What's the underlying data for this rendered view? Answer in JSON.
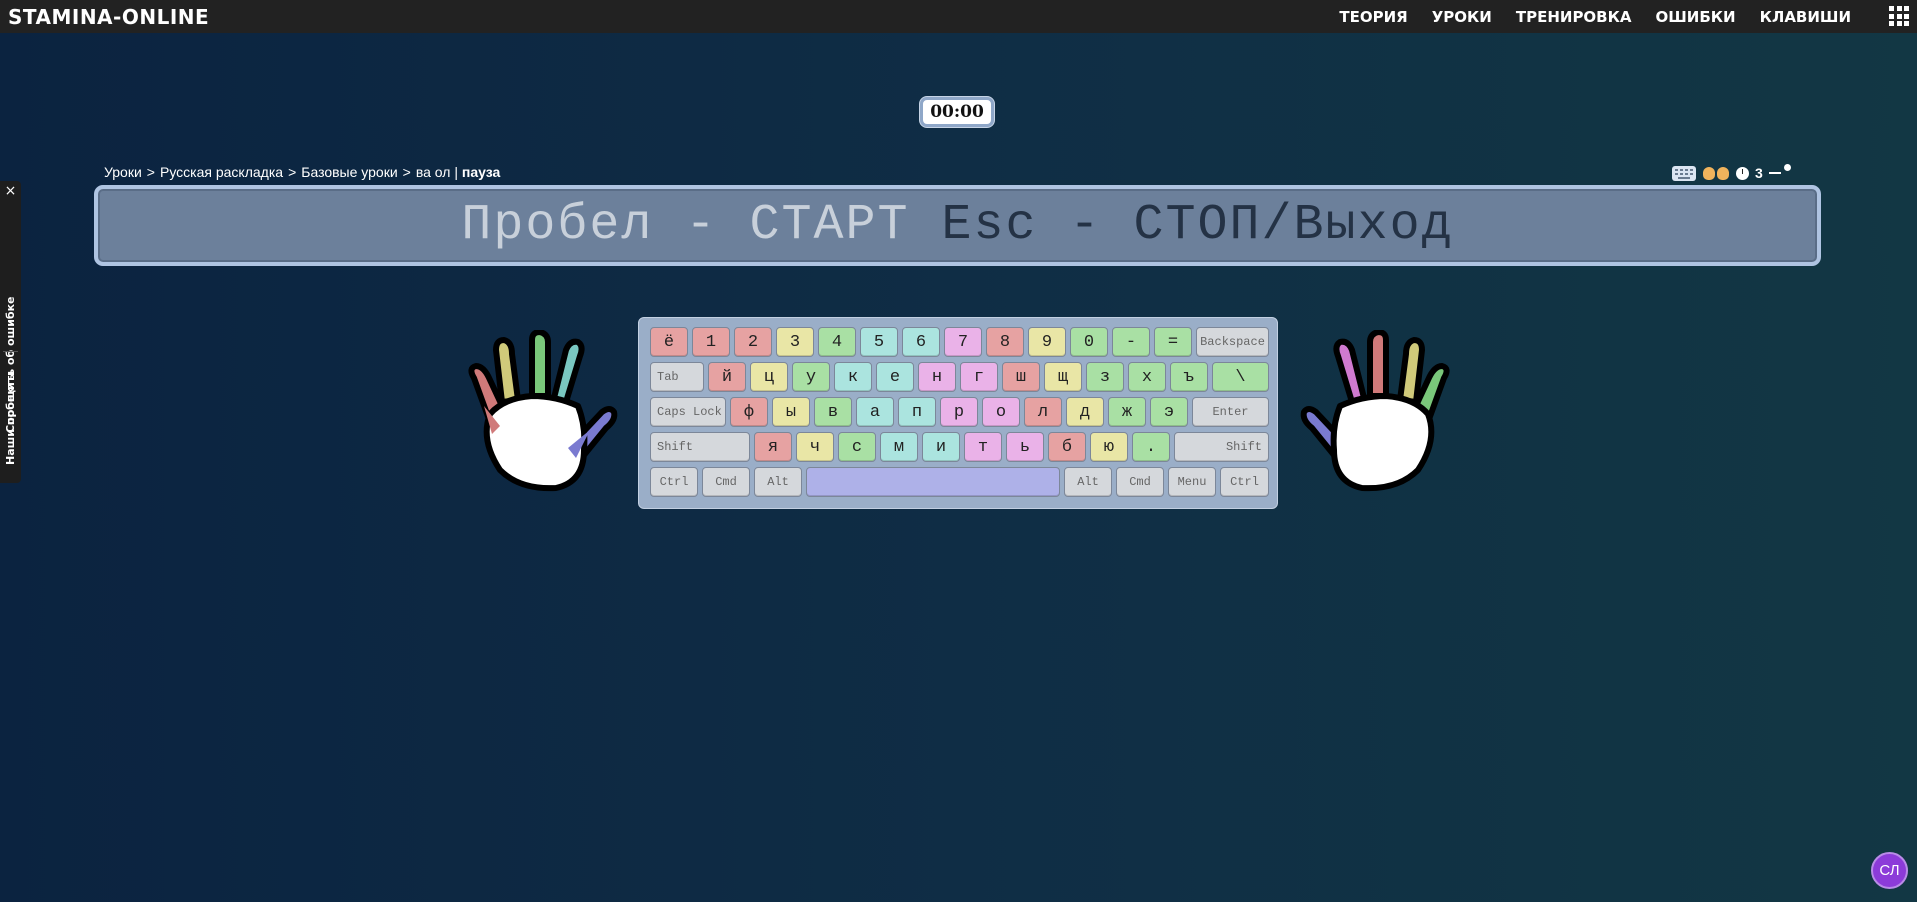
{
  "app": {
    "logo": "STAMINA-ONLINE"
  },
  "nav": {
    "items": [
      {
        "label": "ТЕОРИЯ"
      },
      {
        "label": "УРОКИ"
      },
      {
        "label": "ТРЕНИРОВКА"
      },
      {
        "label": "ОШИБКИ"
      },
      {
        "label": "КЛАВИШИ"
      }
    ],
    "menu_icon": "grid-menu-icon"
  },
  "timer": {
    "value": "00:00"
  },
  "breadcrumb": {
    "lessons": "Уроки",
    "layout": "Русская раскладка",
    "basic": "Базовые уроки",
    "lesson": "ва ол",
    "divider": "|",
    "state": "пауза",
    "separator": ">"
  },
  "tools": {
    "speed": "3"
  },
  "panel": {
    "start_text": "Пробел - СТАРТ",
    "stop_text": "Esc - СТОП/Выход"
  },
  "side_tab": {
    "close": "×",
    "report_error": "Сообщить об ошибке",
    "our_projects": "Наши проекты"
  },
  "keyboard": {
    "row1": [
      "ё",
      "1",
      "2",
      "3",
      "4",
      "5",
      "6",
      "7",
      "8",
      "9",
      "0",
      "-",
      "=",
      "Backspace"
    ],
    "row2": [
      "Tab",
      "й",
      "ц",
      "у",
      "к",
      "е",
      "н",
      "г",
      "ш",
      "щ",
      "з",
      "х",
      "ъ",
      "\\"
    ],
    "row3": [
      "Caps Lock",
      "ф",
      "ы",
      "в",
      "а",
      "п",
      "р",
      "о",
      "л",
      "д",
      "ж",
      "э",
      "Enter"
    ],
    "row4": [
      "Shift",
      "я",
      "ч",
      "с",
      "м",
      "и",
      "т",
      "ь",
      "б",
      "ю",
      ".",
      "Shift"
    ],
    "row5": [
      "Ctrl",
      "Cmd",
      "Alt",
      "",
      "Alt",
      "Cmd",
      "Menu",
      "Ctrl"
    ]
  },
  "colors": {
    "red": "#e6a2a2",
    "yellow": "#e9e6a6",
    "green": "#a9e0a4",
    "cyan": "#abe4df",
    "pink": "#eab2e8",
    "blue": "#aeb1e8"
  },
  "avatar": {
    "initials": "СЛ"
  }
}
